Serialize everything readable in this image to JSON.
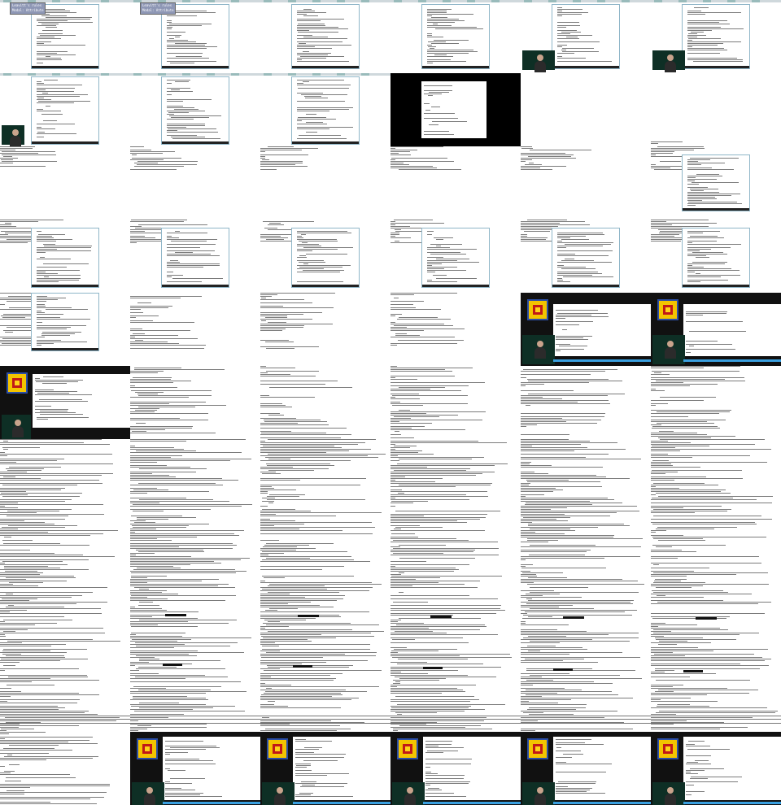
{
  "popup": {
    "line1": "Leavitt's rules",
    "line2": "Modal: Attribute"
  }
}
